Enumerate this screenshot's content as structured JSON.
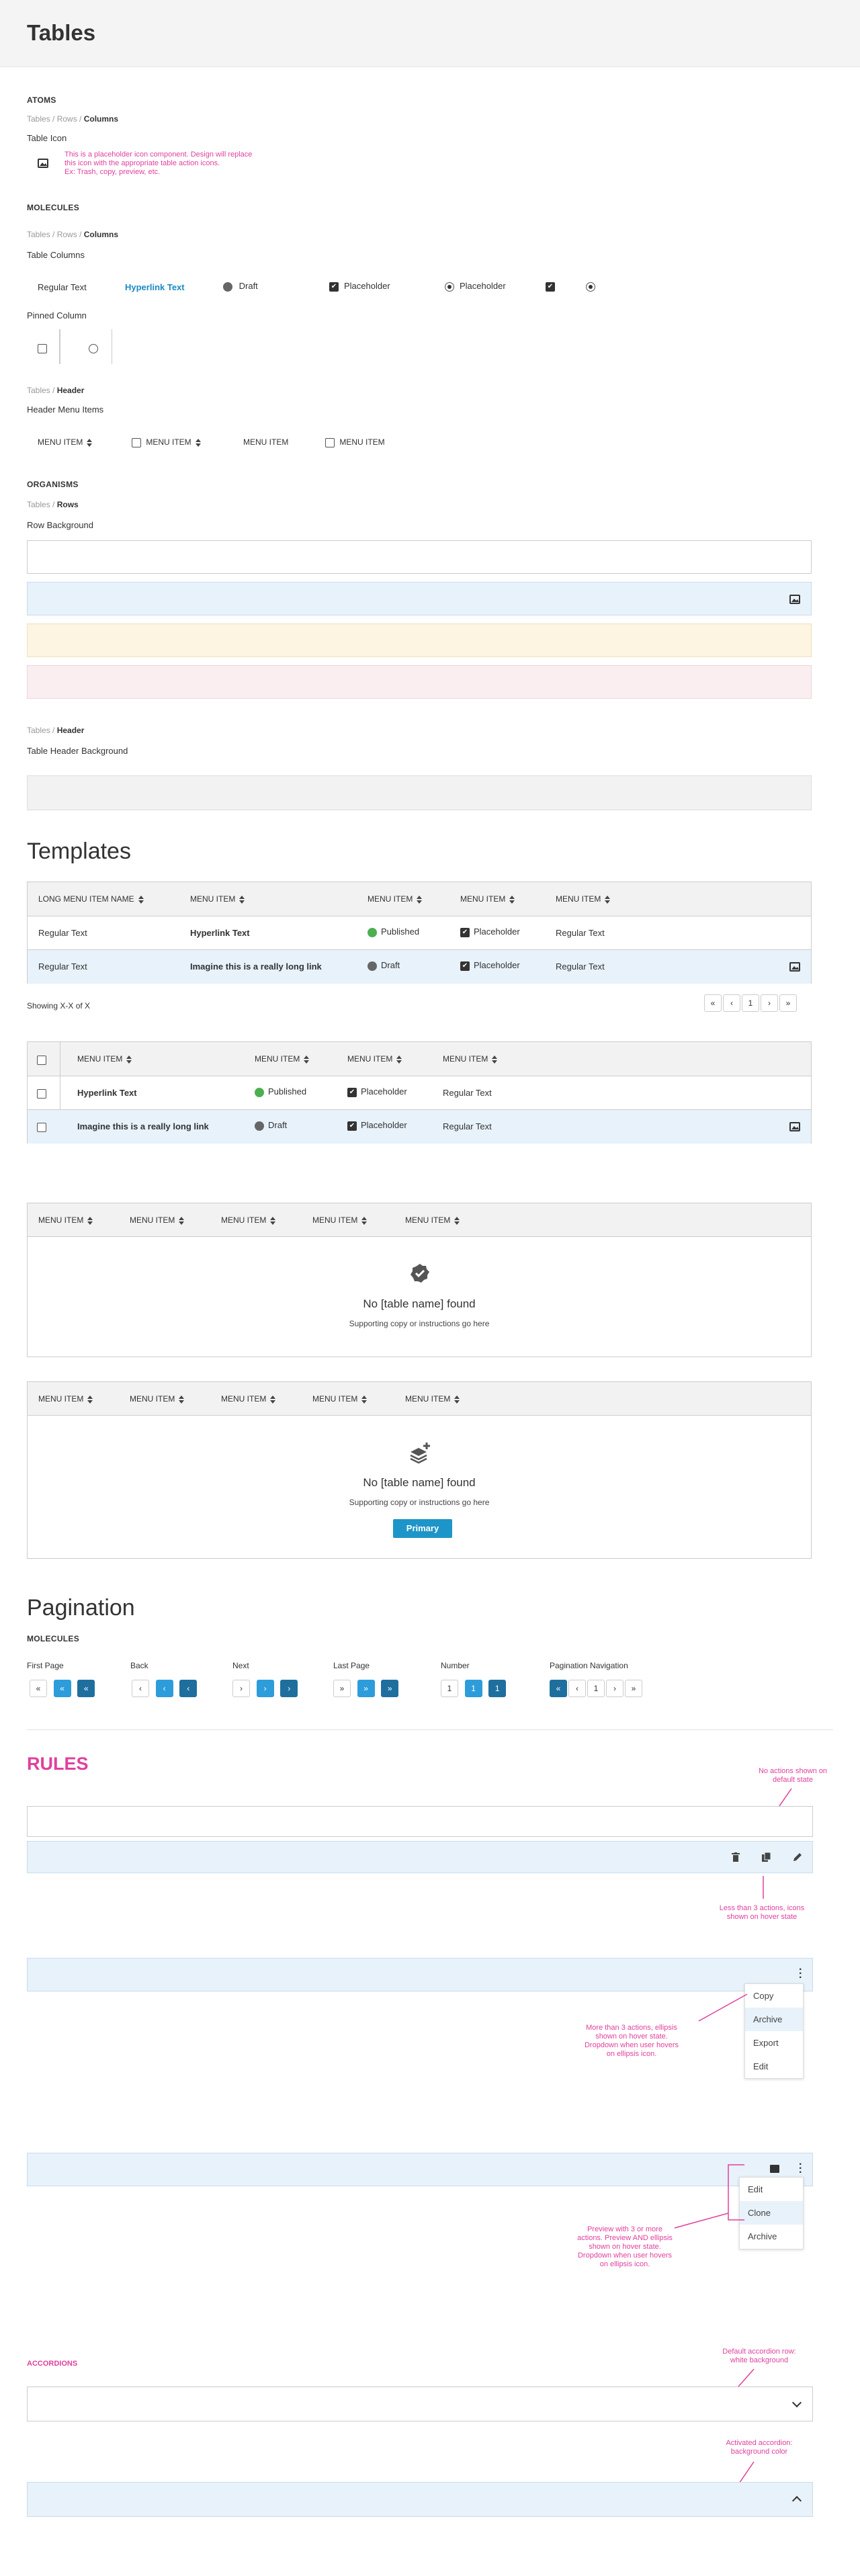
{
  "page_title": "Tables",
  "atoms": {
    "title": "ATOMS",
    "crumb_a": "Tables / Rows / ",
    "crumb_b": "Columns",
    "table_icon_label": "Table Icon",
    "placeholder_note_1": "This is a placeholder icon component. Design will replace",
    "placeholder_note_2": "this icon with the appropriate table action icons.",
    "placeholder_note_3": "Ex: Trash, copy, preview, etc."
  },
  "molecules": {
    "title": "MOLECULES",
    "crumb_a": "Tables / Rows / ",
    "crumb_b": "Columns",
    "table_columns_label": "Table Columns",
    "regular_text": "Regular Text",
    "hyperlink_text": "Hyperlink Text",
    "draft": "Draft",
    "placeholder_1": "Placeholder",
    "placeholder_2": "Placeholder",
    "pinned_column_label": "Pinned Column",
    "header_crumb_a": "Tables / ",
    "header_crumb_b": "Header",
    "header_menu_items_label": "Header Menu Items",
    "menu_items": [
      "MENU ITEM",
      "MENU ITEM",
      "MENU ITEM",
      "MENU ITEM"
    ]
  },
  "organisms": {
    "title": "ORGANISMS",
    "crumb_a": "Tables / ",
    "crumb_b": "Rows",
    "row_background_label": "Row Background",
    "header_crumb_a": "Tables / ",
    "header_crumb_b": "Header",
    "table_header_background_label": "Table Header Background"
  },
  "templates": {
    "title": "Templates",
    "table1": {
      "headers": [
        "LONG MENU ITEM NAME",
        "MENU ITEM",
        "MENU ITEM",
        "MENU ITEM",
        "MENU ITEM"
      ],
      "rows": [
        {
          "c1": "Regular Text",
          "c2": "Hyperlink Text",
          "status": "Published",
          "status_color": "#4caf50",
          "c4": "Placeholder",
          "c5": "Regular Text"
        },
        {
          "c1": "Regular Text",
          "c2": "Imagine this is a really long link",
          "status": "Draft",
          "status_color": "#666666",
          "c4": "Placeholder",
          "c5": "Regular Text"
        }
      ],
      "showing": "Showing X-X of X",
      "page_number": "1"
    },
    "table2": {
      "headers": [
        "MENU ITEM",
        "MENU ITEM",
        "MENU ITEM",
        "MENU ITEM"
      ],
      "rows": [
        {
          "c2": "Hyperlink Text",
          "status": "Published",
          "status_color": "#4caf50",
          "c4": "Placeholder",
          "c5": "Regular Text"
        },
        {
          "c2": "Imagine this is a really long link",
          "status": "Draft",
          "status_color": "#666666",
          "c4": "Placeholder",
          "c5": "Regular Text"
        }
      ]
    },
    "empty1": {
      "headers": [
        "MENU ITEM",
        "MENU ITEM",
        "MENU ITEM",
        "MENU ITEM",
        "MENU ITEM"
      ],
      "title": "No [table name] found",
      "text": "Supporting copy or instructions go here"
    },
    "empty2": {
      "headers": [
        "MENU ITEM",
        "MENU ITEM",
        "MENU ITEM",
        "MENU ITEM",
        "MENU ITEM"
      ],
      "title": "No [table name] found",
      "text": "Supporting copy or instructions go here",
      "button": "Primary"
    }
  },
  "pagination": {
    "title": "Pagination",
    "molecules": "MOLECULES",
    "first_page": "First Page",
    "back": "Back",
    "next": "Next",
    "last_page": "Last Page",
    "number": "Number",
    "pagination_navigation": "Pagination Navigation",
    "num": "1"
  },
  "rules": {
    "title": "RULES",
    "note_no_actions_1": "No actions shown on",
    "note_no_actions_2": "default state",
    "note_less_1": "Less than 3 actions, icons",
    "note_less_2": "shown on hover state",
    "note_more_1": "More than 3 actions, ellipsis",
    "note_more_2": "shown on hover state.",
    "note_more_3": "Dropdown when user hovers",
    "note_more_4": "on ellipsis icon.",
    "menu1": [
      "Copy",
      "Archive",
      "Export",
      "Edit"
    ],
    "note_preview_1": "Preview with 3 or more",
    "note_preview_2": "actions. Preview AND ellipsis",
    "note_preview_3": "shown on hover state.",
    "note_preview_4": "Dropdown when user hovers",
    "note_preview_5": "on ellipsis icon.",
    "menu2": [
      "Edit",
      "Clone",
      "Archive"
    ],
    "accordions": "ACCORDIONS",
    "note_default_1": "Default accordion row:",
    "note_default_2": "white background",
    "note_active_1": "Activated accordion:",
    "note_active_2": "background color"
  },
  "colors": {
    "accent": "#1e95c8",
    "annotation": "#e0409e",
    "hover_row": "#e8f2fa"
  }
}
